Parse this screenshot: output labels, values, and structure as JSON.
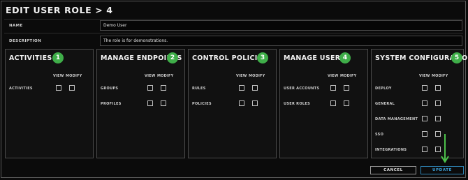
{
  "page": {
    "title": "EDIT USER ROLE > 4"
  },
  "form": {
    "name_label": "NAME",
    "name_value": "Demo User",
    "description_label": "DESCRIPTION",
    "description_value": "The role is for demonstrations."
  },
  "columns": {
    "view": "VIEW",
    "modify": "MODIFY"
  },
  "panels": [
    {
      "title": "ACTIVITIES",
      "badge": "1",
      "items": [
        "ACTIVITIES"
      ]
    },
    {
      "title": "MANAGE ENDPOINTS",
      "badge": "2",
      "items": [
        "GROUPS",
        "PROFILES"
      ]
    },
    {
      "title": "CONTROL POLICIES",
      "badge": "3",
      "items": [
        "RULES",
        "POLICIES"
      ]
    },
    {
      "title": "MANAGE USERS",
      "badge": "4",
      "items": [
        "USER ACCOUNTS",
        "USER ROLES"
      ]
    },
    {
      "title": "SYSTEM CONFIGURATION",
      "badge": "5",
      "items": [
        "DEPLOY",
        "GENERAL",
        "DATA MANAGEMENT",
        "SSO",
        "INTEGRATIONS"
      ]
    }
  ],
  "buttons": {
    "cancel": "CANCEL",
    "update": "UPDATE"
  },
  "colors": {
    "badge": "#3fae49",
    "arrow": "#4cc04a",
    "update": "#3ba0d8"
  },
  "icons": {
    "annotation_arrow": "arrow-down-icon"
  }
}
